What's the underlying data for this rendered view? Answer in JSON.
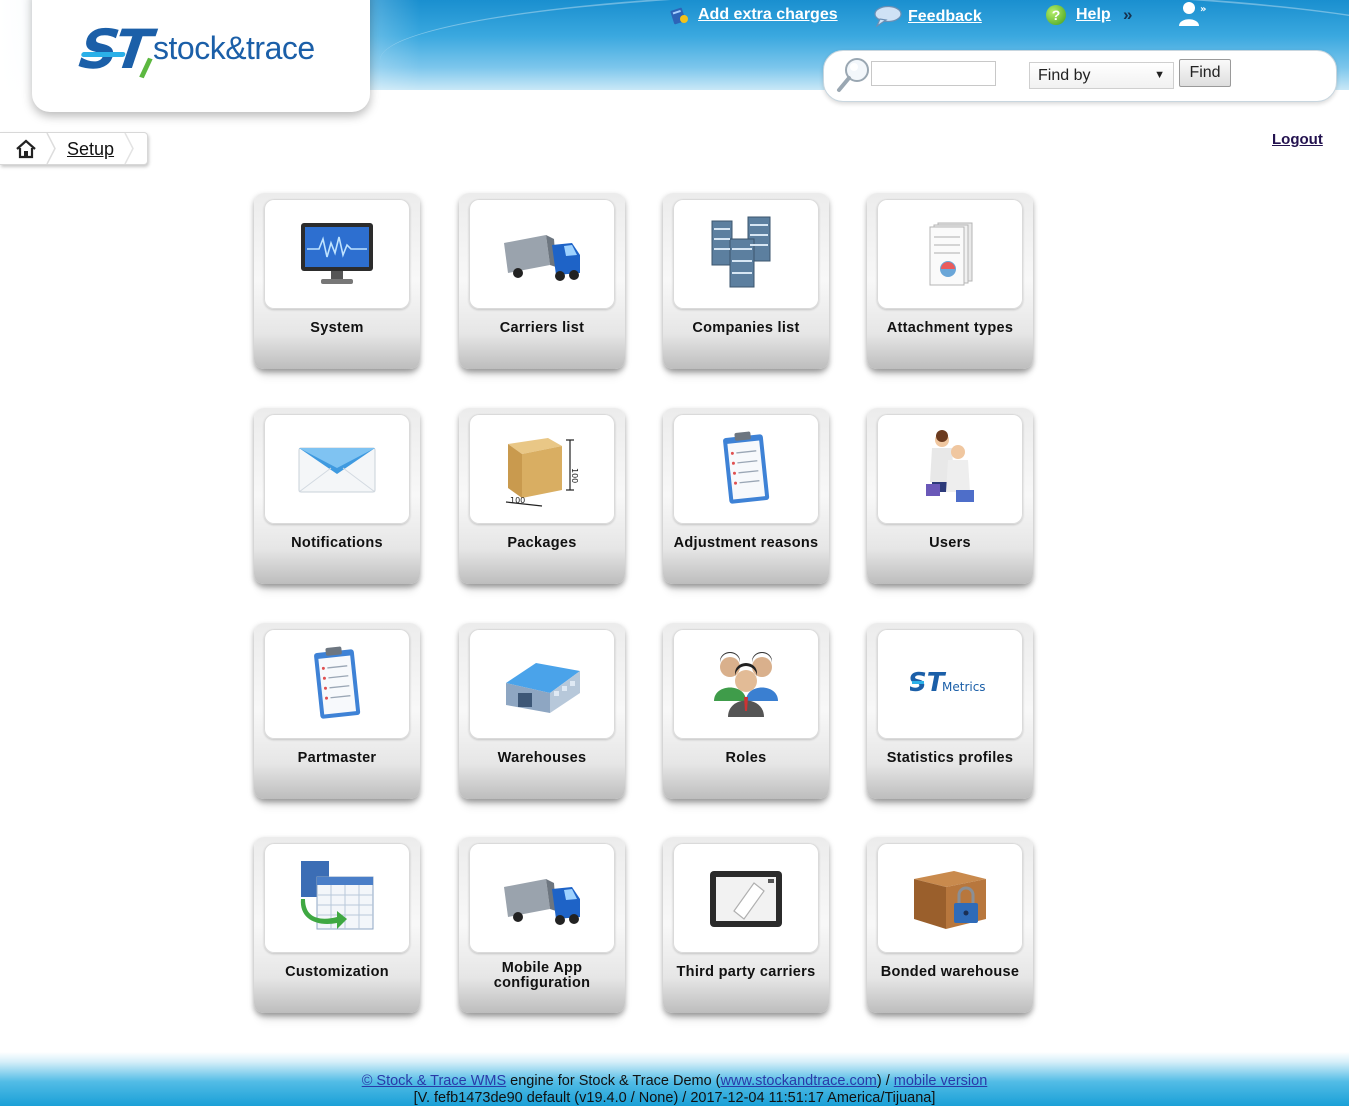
{
  "header": {
    "logo_text": "stock&trace",
    "logo_mark": "ST",
    "links": {
      "add_extra_charges": "Add extra charges",
      "feedback": "Feedback",
      "help": "Help",
      "more": "»"
    },
    "search": {
      "input_value": "",
      "find_by_label": "Find by",
      "find_button": "Find"
    }
  },
  "breadcrumb": {
    "current": "Setup"
  },
  "logout_label": "Logout",
  "tiles": [
    {
      "label": "System",
      "icon": "monitor-icon"
    },
    {
      "label": "Carriers list",
      "icon": "truck-icon"
    },
    {
      "label": "Companies list",
      "icon": "servers-icon"
    },
    {
      "label": "Attachment types",
      "icon": "documents-stack-icon"
    },
    {
      "label": "Notifications",
      "icon": "envelope-icon"
    },
    {
      "label": "Packages",
      "icon": "box-dimensions-icon"
    },
    {
      "label": "Adjustment reasons",
      "icon": "clipboard-icon"
    },
    {
      "label": "Users",
      "icon": "users-icon"
    },
    {
      "label": "Partmaster",
      "icon": "clipboard-icon"
    },
    {
      "label": "Warehouses",
      "icon": "warehouse-icon"
    },
    {
      "label": "Roles",
      "icon": "people-group-icon"
    },
    {
      "label": "Statistics profiles",
      "icon": "stmetrics-logo-icon"
    },
    {
      "label": "Customization",
      "icon": "table-arrow-icon"
    },
    {
      "label": "Mobile App configuration",
      "label_line1": "Mobile App",
      "label_line2": "configuration",
      "icon": "truck-icon"
    },
    {
      "label": "Third party carriers",
      "icon": "tablet-icon"
    },
    {
      "label": "Bonded warehouse",
      "icon": "locked-box-icon"
    }
  ],
  "stmetrics_text": "ST",
  "stmetrics_suffix": "Metrics",
  "package_dim": "100",
  "footer": {
    "copyright_link": "© Stock & Trace WMS",
    "engine_text": " engine for Stock & Trace Demo (",
    "site_link": "www.stockandtrace.com",
    "sep_text": ") / ",
    "mobile_link": "mobile version",
    "version_line": "[V. fefb1473de90 default (v19.4.0 / None) / 2017-12-04 11:51:17 America/Tijuana]"
  },
  "colors": {
    "header_blue": "#1a8fcf",
    "logo_blue": "#1b5fa8",
    "link_dark": "#23124f",
    "footer_link": "#2a3aa8"
  }
}
